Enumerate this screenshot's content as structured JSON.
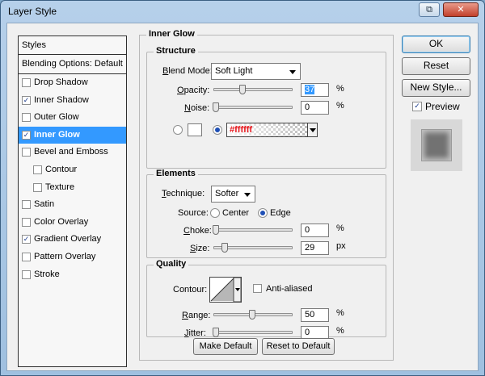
{
  "window": {
    "title": "Layer Style",
    "restore_glyph": "⧉",
    "close_glyph": "✕"
  },
  "styles_panel": {
    "header": "Styles",
    "blending_options": "Blending Options: Default",
    "items": [
      {
        "label": "Drop Shadow",
        "checked": false,
        "indent": false,
        "active": false
      },
      {
        "label": "Inner Shadow",
        "checked": true,
        "indent": false,
        "active": false
      },
      {
        "label": "Outer Glow",
        "checked": false,
        "indent": false,
        "active": false
      },
      {
        "label": "Inner Glow",
        "checked": true,
        "indent": false,
        "active": true
      },
      {
        "label": "Bevel and Emboss",
        "checked": false,
        "indent": false,
        "active": false
      },
      {
        "label": "Contour",
        "checked": false,
        "indent": true,
        "active": false
      },
      {
        "label": "Texture",
        "checked": false,
        "indent": true,
        "active": false
      },
      {
        "label": "Satin",
        "checked": false,
        "indent": false,
        "active": false
      },
      {
        "label": "Color Overlay",
        "checked": false,
        "indent": false,
        "active": false
      },
      {
        "label": "Gradient Overlay",
        "checked": true,
        "indent": false,
        "active": false
      },
      {
        "label": "Pattern Overlay",
        "checked": false,
        "indent": false,
        "active": false
      },
      {
        "label": "Stroke",
        "checked": false,
        "indent": false,
        "active": false
      }
    ]
  },
  "inner_glow": {
    "title": "Inner Glow",
    "structure": {
      "title": "Structure",
      "blend_mode_label_u": "B",
      "blend_mode_label_rest": "lend Mode:",
      "blend_mode_value": "Soft Light",
      "opacity_label_u": "O",
      "opacity_label_rest": "pacity:",
      "opacity_value": "37",
      "opacity_unit": "%",
      "opacity_pct": 37,
      "noise_label_u": "N",
      "noise_label_rest": "oise:",
      "noise_value": "0",
      "noise_unit": "%",
      "noise_pct": 0,
      "gradient_text": "#ffffff",
      "color_mode": "gradient"
    },
    "elements": {
      "title": "Elements",
      "technique_label_u": "T",
      "technique_label_rest": "echnique:",
      "technique_value": "Softer",
      "source_label": "Source:",
      "source_center": "Center",
      "source_edge": "Edge",
      "source_selected": "edge",
      "choke_label_u": "C",
      "choke_label_rest": "hoke:",
      "choke_value": "0",
      "choke_unit": "%",
      "choke_pct": 0,
      "size_label_u": "S",
      "size_label_rest": "ize:",
      "size_value": "29",
      "size_unit": "px",
      "size_pct": 12
    },
    "quality": {
      "title": "Quality",
      "contour_label": "Contour:",
      "anti_aliased_label": "Anti-aliased",
      "anti_aliased": false,
      "range_label_u": "R",
      "range_label_rest": "ange:",
      "range_value": "50",
      "range_unit": "%",
      "range_pct": 50,
      "jitter_label_u": "J",
      "jitter_label_rest": "itter:",
      "jitter_value": "0",
      "jitter_unit": "%",
      "jitter_pct": 0
    },
    "make_default": "Make Default",
    "reset_to_default": "Reset to Default"
  },
  "actions": {
    "ok": "OK",
    "reset": "Reset",
    "new_style": "New Style...",
    "preview_label": "Preview",
    "preview_checked": true
  },
  "colors": {
    "selection": "#3399ff",
    "gradient_text": "#e8151b",
    "dialog_bg": "#f0f0f0"
  }
}
